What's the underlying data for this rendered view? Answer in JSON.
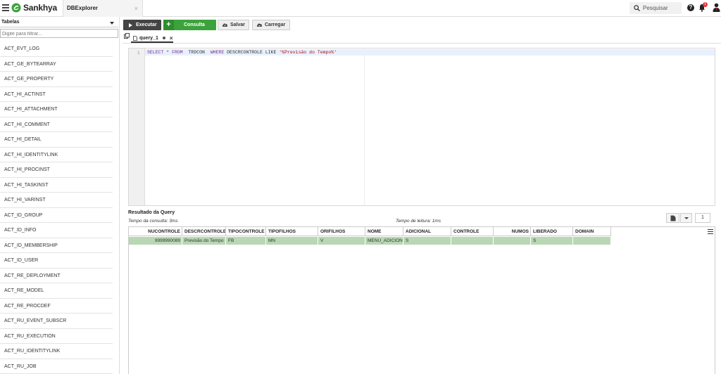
{
  "topbar": {
    "brand": "Sankhya",
    "app_tab": "DBExplorer",
    "app_tab_close": "×",
    "search_placeholder": "Pesquisar",
    "help": "?",
    "notification_count": "1"
  },
  "sidebar": {
    "selector_value": "Tabelas",
    "filter_placeholder": "Digite para filtrar...",
    "tables": [
      "ACT_EVT_LOG",
      "ACT_GE_BYTEARRAY",
      "ACT_GE_PROPERTY",
      "ACT_HI_ACTINST",
      "ACT_HI_ATTACHMENT",
      "ACT_HI_COMMENT",
      "ACT_HI_DETAIL",
      "ACT_HI_IDENTITYLINK",
      "ACT_HI_PROCINST",
      "ACT_HI_TASKINST",
      "ACT_HI_VARINST",
      "ACT_ID_GROUP",
      "ACT_ID_INFO",
      "ACT_ID_MEMBERSHIP",
      "ACT_ID_USER",
      "ACT_RE_DEPLOYMENT",
      "ACT_RE_MODEL",
      "ACT_RE_PROCDEF",
      "ACT_RU_EVENT_SUBSCR",
      "ACT_RU_EXECUTION",
      "ACT_RU_IDENTITYLINK",
      "ACT_RU_JOB"
    ]
  },
  "toolbar": {
    "execute_label": "Executar",
    "query_label": "Consulta",
    "save_label": "Salvar",
    "load_label": "Carregar"
  },
  "query_tab": {
    "label": "query_1",
    "close": "×"
  },
  "editor": {
    "line_number": "1",
    "code_tokens": [
      {
        "t": "SELECT",
        "k": "kw"
      },
      {
        "t": " * ",
        "k": ""
      },
      {
        "t": "FROM",
        "k": "kw"
      },
      {
        "t": "  TRDCON  ",
        "k": ""
      },
      {
        "t": "WHERE",
        "k": "kw"
      },
      {
        "t": " DESCRCONTROLE LIKE ",
        "k": ""
      },
      {
        "t": "'%Previsão do Tempo%'",
        "k": "str"
      }
    ]
  },
  "results": {
    "title": "Resultado da Query",
    "query_time": "Tempo da consulta: 3ms",
    "read_time": "Tempo de leitura: 1ms",
    "page": "1",
    "columns": [
      "NUCONTROLE",
      "DESCRCONTROLE",
      "TIPOCONTROLE",
      "TIPOFILHOS",
      "ORIFILHOS",
      "NOME",
      "ADICIONAL",
      "CONTROLE",
      "NUMOS",
      "LIBERADO",
      "DOMAIN"
    ],
    "rows": [
      [
        "9999990089",
        "Previsão do Tempo",
        "FB",
        "MN",
        "V",
        "MENU_ADICIONAL",
        "S",
        "",
        "",
        "S",
        ""
      ]
    ]
  },
  "colors": {
    "execute_button": "#444444",
    "query_button": "#3ca33c",
    "selected_row": "#b9d7b4",
    "notification_badge": "#ee3333"
  }
}
